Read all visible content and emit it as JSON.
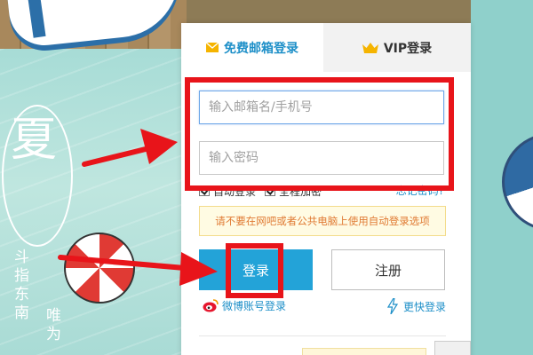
{
  "background": {
    "title_glyph": "夏",
    "vertical_text_1": "斗指东南",
    "vertical_text_2": "唯为"
  },
  "tabs": {
    "email_label": "免费邮箱登录",
    "vip_label": "VIP登录"
  },
  "form": {
    "username_placeholder": "输入邮箱名/手机号",
    "password_placeholder": "输入密码",
    "auto_login_label": "自动登录",
    "encrypt_label": "全程加密",
    "forgot_label": "忘记密码?",
    "notice": "请不要在网吧或者公共电脑上使用自动登录选项"
  },
  "buttons": {
    "login_label": "登录",
    "register_label": "注册"
  },
  "links": {
    "weibo_label": "微博账号登录",
    "quick_label": "更快登录"
  },
  "colors": {
    "accent": "#1d8fc8",
    "login_button": "#23a3d8",
    "annotation": "#e8141a",
    "notice_text": "#e07a33"
  }
}
